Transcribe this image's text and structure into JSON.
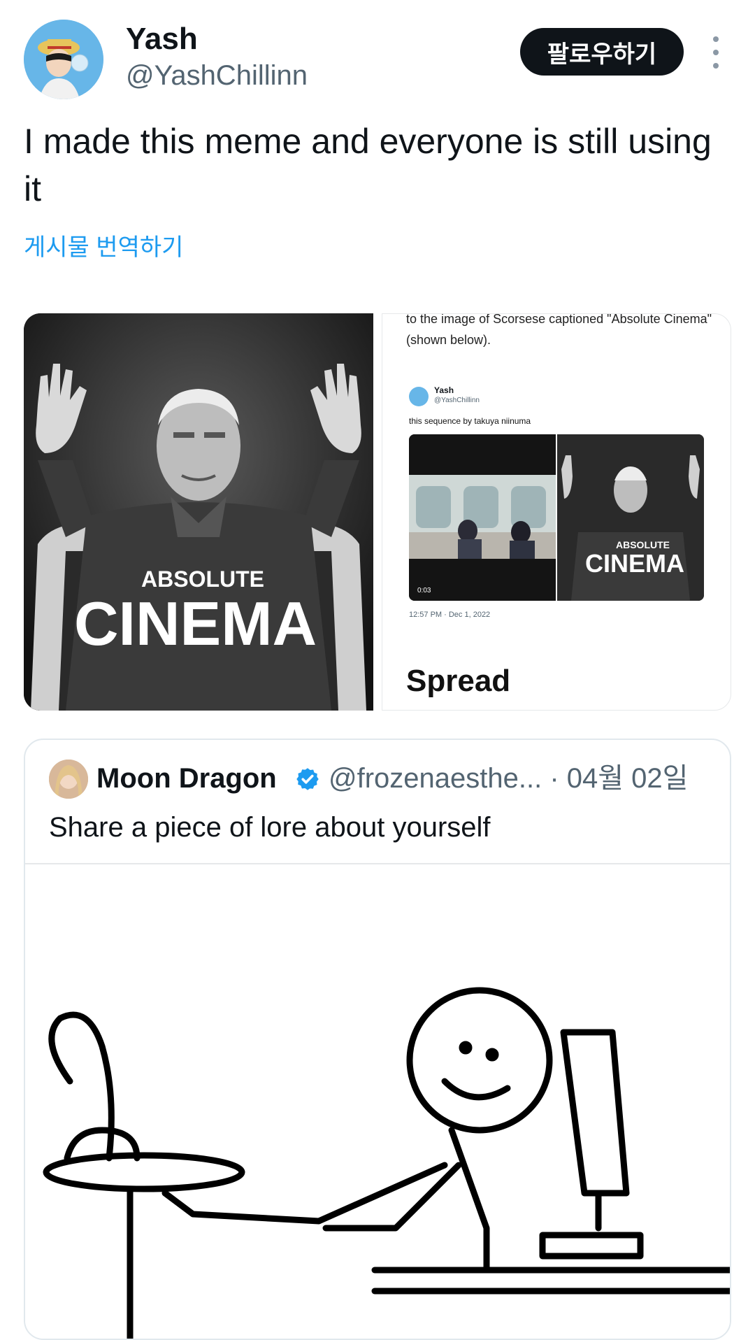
{
  "user": {
    "display_name": "Yash",
    "handle": "@YashChillinn"
  },
  "header": {
    "follow_label": "팔로우하기"
  },
  "post": {
    "text": "I made this meme and everyone is still using it",
    "translate_label": "게시물 번역하기"
  },
  "media": {
    "left": {
      "line1": "ABSOLUTE",
      "line2": "CINEMA"
    },
    "right": {
      "snippet_top": "to the image of Scorsese captioned \"Absolute Cinema\" (shown below).",
      "embed_name": "Yash",
      "embed_handle": "@YashChillinn",
      "embed_text": "this sequence by takuya niinuma",
      "video_time": "0:03",
      "thumb_line1": "ABSOLUTE",
      "thumb_line2": "CINEMA",
      "timestamp": "12:57 PM · Dec 1, 2022",
      "heading": "Spread"
    }
  },
  "quote": {
    "name": "Moon Dragon",
    "handle": "@frozenaesthe...",
    "date": "· 04월 02일",
    "text": "Share a piece of lore about yourself"
  },
  "colors": {
    "link": "#1d9bf0",
    "verified": "#1d9bf0",
    "follow_bg": "#0f1419"
  }
}
